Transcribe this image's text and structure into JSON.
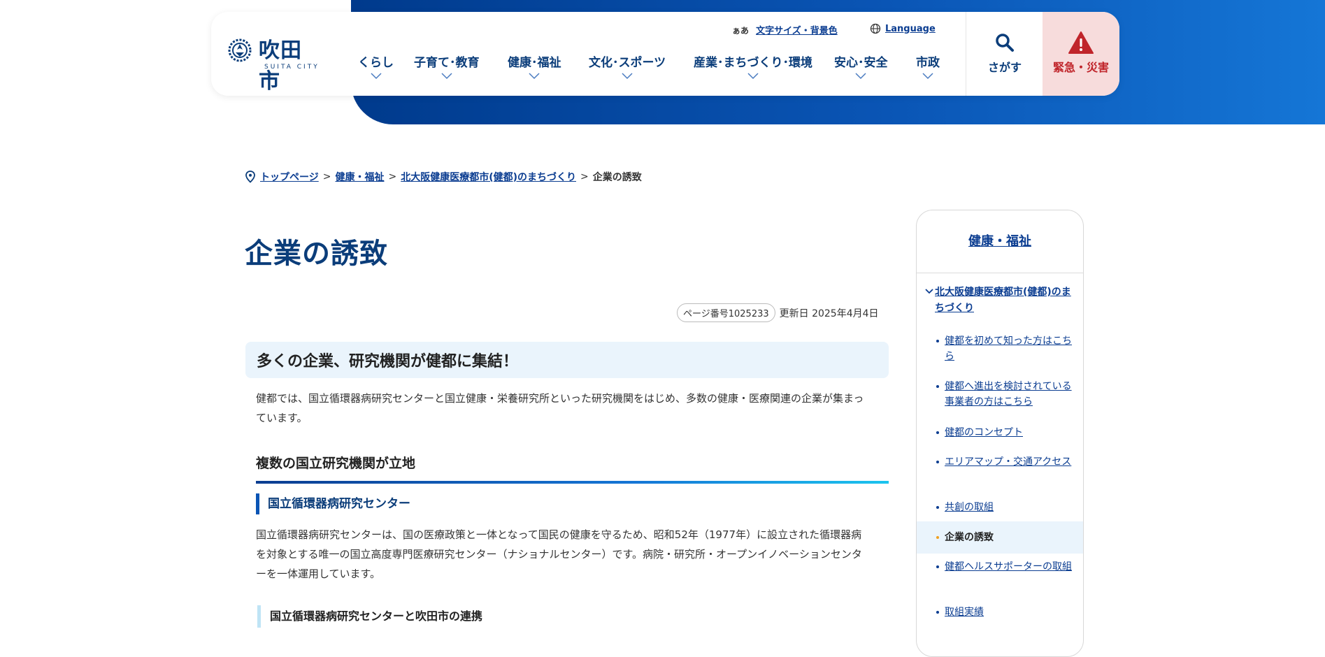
{
  "header": {
    "logo_text": "吹田市",
    "logo_sub": "SUITA CITY",
    "util": {
      "size_prefix": "ぁあ",
      "size_label": "文字サイズ・背景色",
      "language_label": "Language"
    },
    "nav": [
      {
        "label": "くらし"
      },
      {
        "label": "子育て･教育"
      },
      {
        "label": "健康･福祉"
      },
      {
        "label": "文化･スポーツ"
      },
      {
        "label": "産業･まちづくり･環境"
      },
      {
        "label": "安心･安全"
      },
      {
        "label": "市政"
      }
    ],
    "search_label": "さがす",
    "emergency_label": "緊急・災害"
  },
  "breadcrumb": {
    "items": [
      "トップページ",
      "健康・福祉",
      "北大阪健康医療都市(健都)のまちづくり"
    ],
    "separator": ">",
    "current": "企業の誘致"
  },
  "main": {
    "title": "企業の誘致",
    "page_number": "ページ番号1025233",
    "updated": "更新日 2025年4月4日",
    "h2": "多くの企業、研究機関が健都に集結！",
    "p1": "健都では、国立循環器病研究センターと国立健康・栄養研究所といった研究機関をはじめ、多数の健康・医療関連の企業が集まっています。",
    "h3": "複数の国立研究機関が立地",
    "h4": "国立循環器病研究センター",
    "p2": "国立循環器病研究センターは、国の医療政策と一体となって国民の健康を守るため、昭和52年（1977年）に設立された循環器病を対象とする唯一の国立高度専門医療研究センター（ナショナルセンター）です。病院・研究所・オープンイノベーションセンターを一体運用しています。",
    "h5": "国立循環器病研究センターと吹田市の連携"
  },
  "side": {
    "title": "健康・福祉",
    "parent": "北大阪健康医療都市(健都)のまちづくり",
    "items": [
      {
        "label": "健都を初めて知った方はこちら"
      },
      {
        "label": "健都へ進出を検討されている事業者の方はこちら"
      },
      {
        "label": "健都のコンセプト"
      },
      {
        "label": "エリアマップ・交通アクセス"
      },
      {
        "label": "共創の取組"
      },
      {
        "label": "企業の誘致"
      },
      {
        "label": "健都ヘルスサポーターの取組"
      },
      {
        "label": "取組実績"
      }
    ]
  },
  "colors": {
    "brand_blue": "#0b3d91",
    "accent_light": "#eaf4fc",
    "emergency_bg": "#f7dcdc",
    "emergency_text": "#c0252b"
  },
  "icons": {
    "logo": "city-emblem-icon",
    "language": "globe-icon",
    "search": "search-icon",
    "emergency": "warning-icon",
    "breadcrumb": "location-pin-icon",
    "nav_chevron": "chevron-down-icon"
  }
}
